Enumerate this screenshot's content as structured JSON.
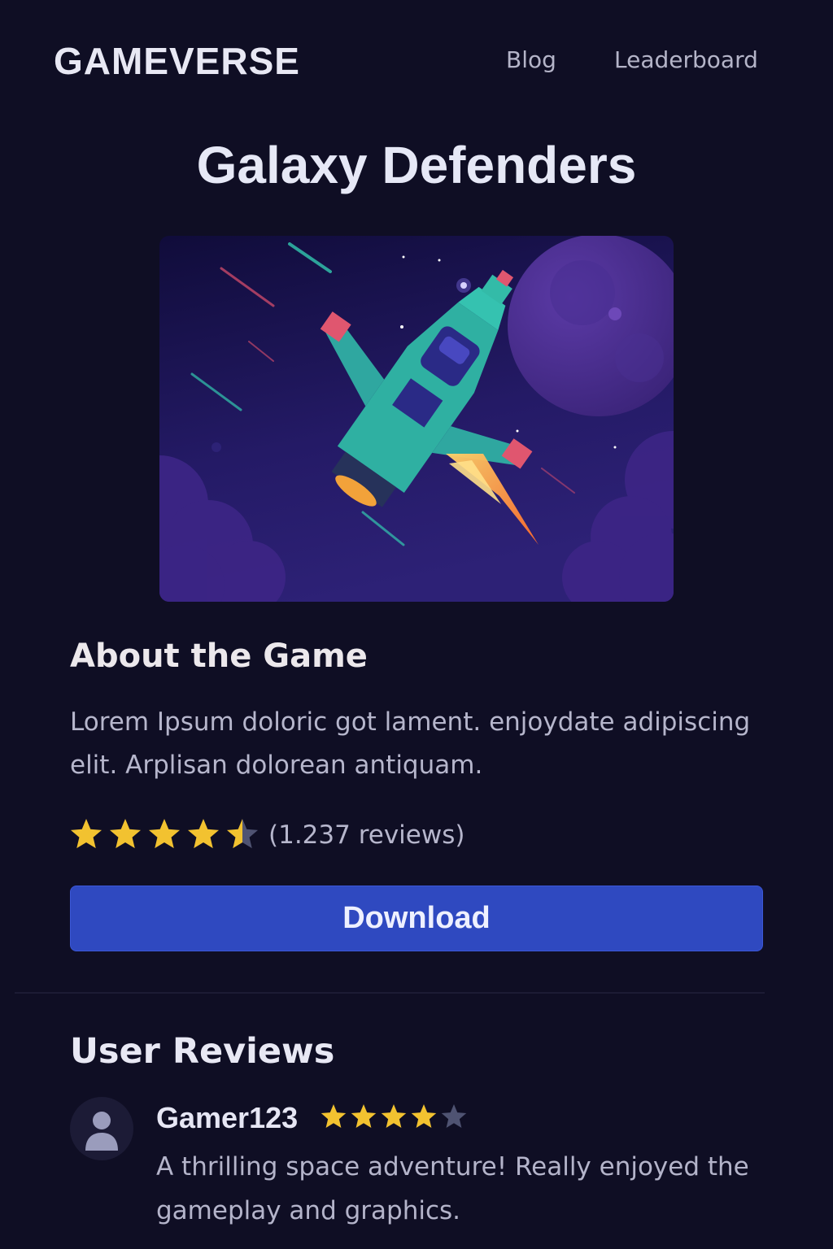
{
  "header": {
    "brand": "GAMEVERSE",
    "nav": [
      "Blog",
      "Leaderboard"
    ]
  },
  "game": {
    "title": "Galaxy Defenders",
    "hero_image": "spaceship-flying-past-planet-illustration",
    "about_heading": "About the Game",
    "about_text": "Lorem Ipsum doloric got lament. enjoydate adipiscing elit. Arplisan dolorean antiquam.",
    "rating": 4.5,
    "rating_max": 5,
    "review_count_text": "(1.237 reviews)",
    "download_label": "Download"
  },
  "reviews": {
    "heading": "User Reviews",
    "items": [
      {
        "user": "Gamer123",
        "avatar": "user-avatar-icon",
        "rating": 4,
        "rating_max": 5,
        "text": "A thrilling space adventure! Really enjoyed the gameplay and graphics."
      }
    ]
  },
  "colors": {
    "background": "#0f0e24",
    "accent": "#2f49c0",
    "star_filled": "#f2c230",
    "star_empty": "#4f5372"
  }
}
